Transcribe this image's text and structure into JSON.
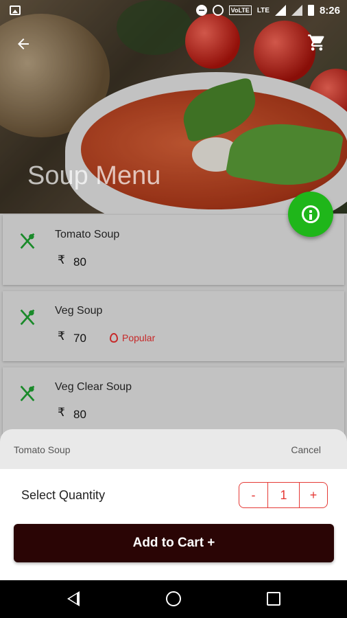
{
  "status_bar": {
    "time": "8:26",
    "network": "LTE",
    "volte": "VoLTE"
  },
  "header": {
    "title": "Soup Menu"
  },
  "menu_items": [
    {
      "name": "Tomato Soup",
      "currency": "₹",
      "price": "80",
      "badge": ""
    },
    {
      "name": "Veg Soup",
      "currency": "₹",
      "price": "70",
      "badge": "Popular"
    },
    {
      "name": "Veg Clear Soup",
      "currency": "₹",
      "price": "80",
      "badge": ""
    }
  ],
  "sheet": {
    "item_name": "Tomato Soup",
    "cancel_label": "Cancel",
    "quantity_label": "Select Quantity",
    "decrement": "-",
    "quantity": "1",
    "increment": "+",
    "add_button": "Add to Cart +"
  },
  "colors": {
    "fab": "#1fb61a",
    "accent": "#e53935",
    "add_button": "#2a0505",
    "veg_icon": "#1a8a2a"
  }
}
